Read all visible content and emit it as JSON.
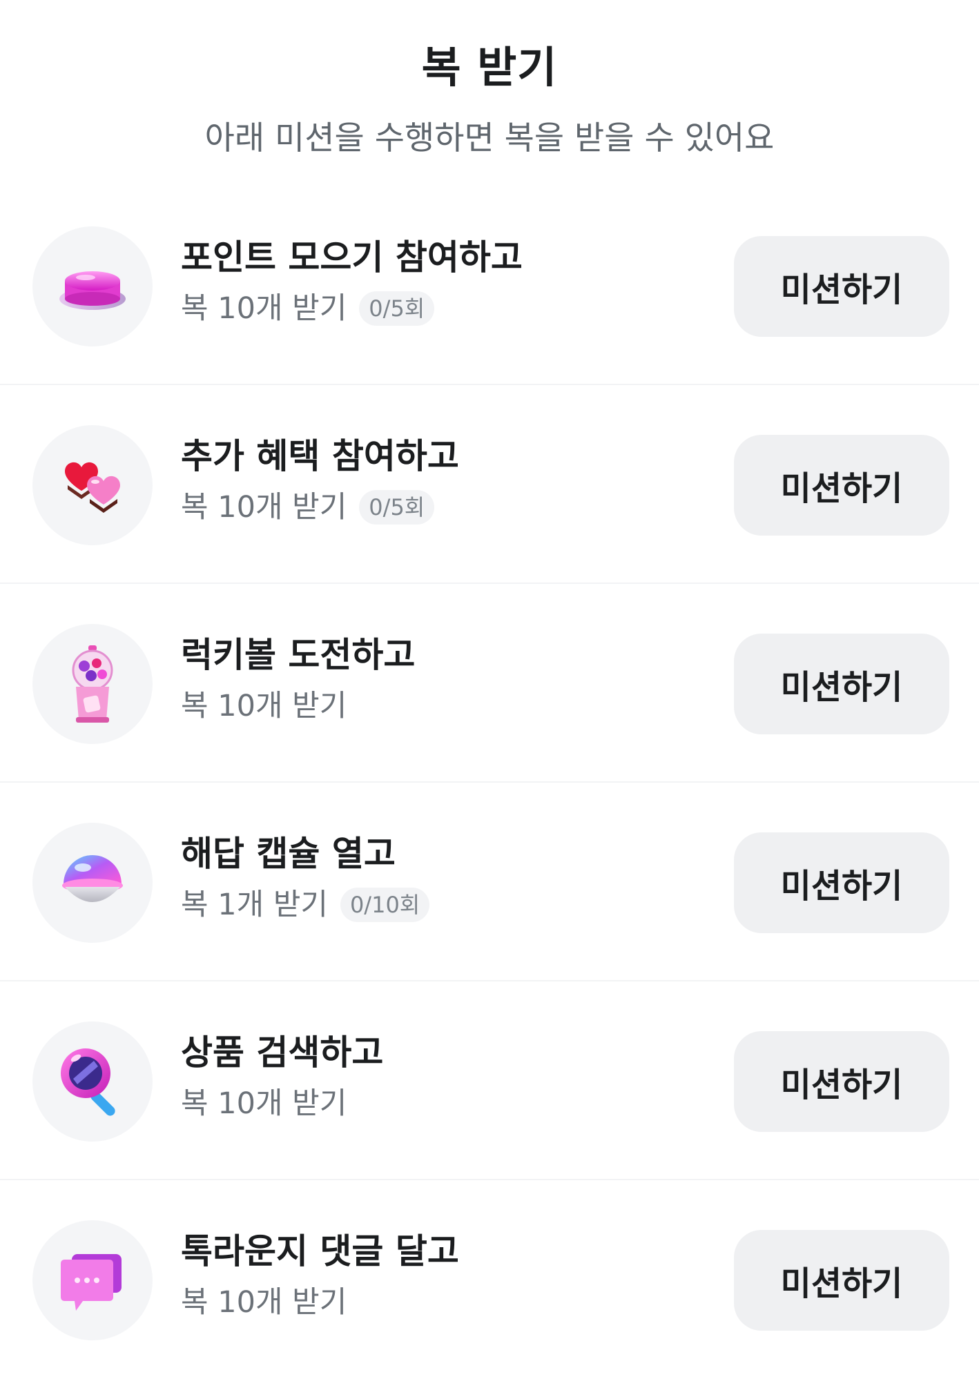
{
  "header": {
    "title": "복 받기",
    "subtitle": "아래 미션을 수행하면 복을 받을 수 있어요"
  },
  "missions": [
    {
      "icon": "pink-button-icon",
      "title": "포인트 모으기 참여하고",
      "reward": "복 10개 받기",
      "count": "0/5회",
      "button": "미션하기"
    },
    {
      "icon": "hearts-icon",
      "title": "추가 혜택 참여하고",
      "reward": "복 10개 받기",
      "count": "0/5회",
      "button": "미션하기"
    },
    {
      "icon": "gumball-machine-icon",
      "title": "럭키볼 도전하고",
      "reward": "복 10개 받기",
      "button": "미션하기"
    },
    {
      "icon": "capsule-icon",
      "title": "해답 캡슐 열고",
      "reward": "복 1개 받기",
      "count": "0/10회",
      "button": "미션하기"
    },
    {
      "icon": "magnifier-icon",
      "title": "상품 검색하고",
      "reward": "복 10개 받기",
      "button": "미션하기"
    },
    {
      "icon": "chat-bubble-icon",
      "title": "톡라운지 댓글 달고",
      "reward": "복 10개 받기",
      "button": "미션하기"
    }
  ],
  "colors": {
    "button_bg": "#eff0f2",
    "icon_circle_bg": "#f4f5f7",
    "title_text": "#1b1d1f",
    "sub_text": "#6b7178",
    "accent_pink": "#f04bd6"
  }
}
